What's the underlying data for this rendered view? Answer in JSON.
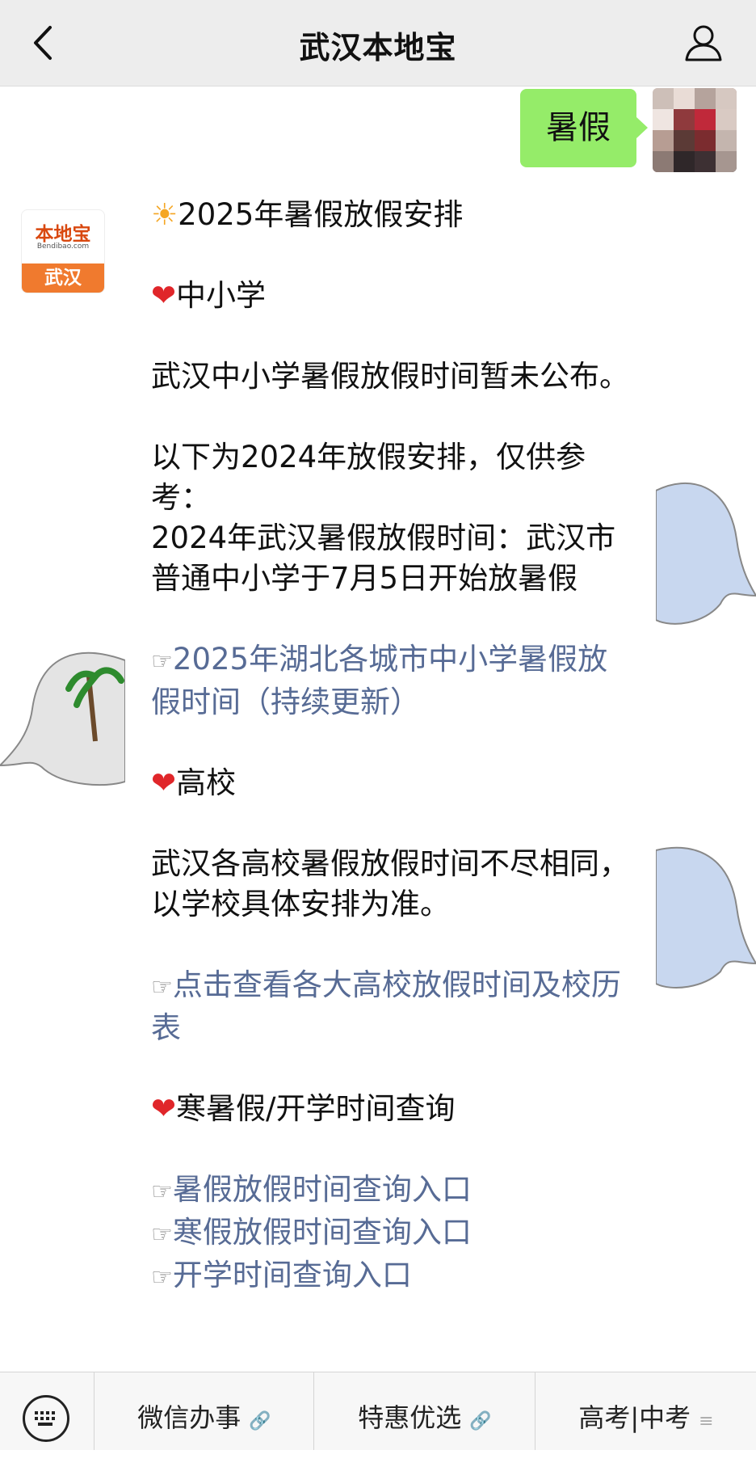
{
  "header": {
    "title": "武汉本地宝",
    "back_icon": "chevron-left-icon",
    "profile_icon": "person-icon"
  },
  "user_message": {
    "text": "暑假",
    "bubble_color": "#95ec69"
  },
  "bot": {
    "avatar": {
      "logo_text": "本地宝",
      "logo_url": "Bendibao.com",
      "city": "武汉"
    },
    "message": {
      "title": "2025年暑假放假安排",
      "section1_title": "中小学",
      "section1_text": "武汉中小学暑假放假时间暂未公布。",
      "section1_ref": "以下为2024年放假安排，仅供参考：",
      "section1_detail": "2024年武汉暑假放假时间：武汉市普通中小学于7月5日开始放暑假",
      "section1_link": "2025年湖北各城市中小学暑假放假时间（持续更新）",
      "section2_title": "高校",
      "section2_text": "武汉各高校暑假放假时间不尽相同，以学校具体安排为准。",
      "section2_link": "点击查看各大高校放假时间及校历表",
      "section3_title": "寒暑假/开学时间查询",
      "link_summer": "暑假放假时间查询入口",
      "link_winter": "寒假放假时间查询入口",
      "link_school": "开学时间查询入口"
    }
  },
  "bottom_menu": {
    "keyboard_icon": "keyboard-icon",
    "items": [
      {
        "label": "微信办事",
        "icon": "link-icon"
      },
      {
        "label": "特惠优选",
        "icon": "link-icon"
      },
      {
        "label": "高考|中考",
        "icon": "menu-icon"
      }
    ]
  },
  "colors": {
    "link": "#576b95",
    "header_bg": "#ededed",
    "heart": "#e0262a"
  }
}
